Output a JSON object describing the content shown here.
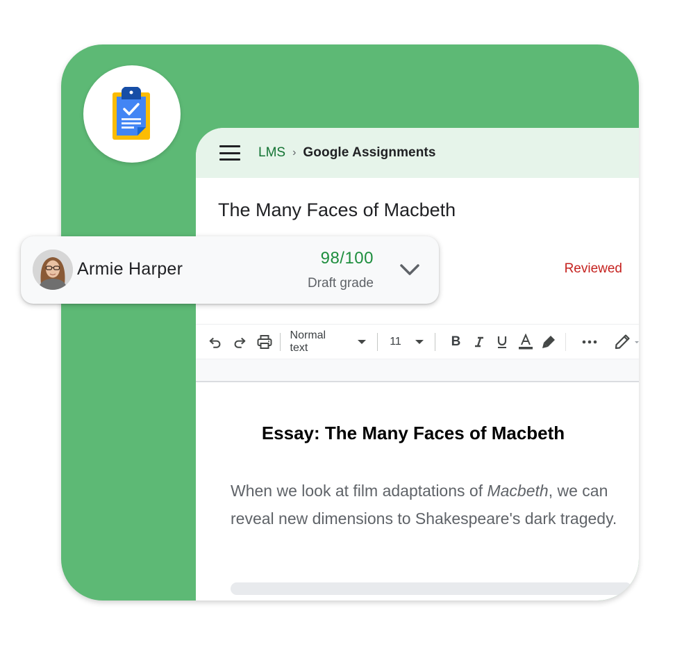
{
  "app": {
    "logo_icon": "clipboard-check-icon"
  },
  "header": {
    "menu_icon": "hamburger-menu-icon",
    "breadcrumb": {
      "root": "LMS",
      "separator": "›",
      "current": "Google Assignments"
    }
  },
  "assignment": {
    "title": "The Many Faces of Macbeth",
    "status": "Reviewed"
  },
  "student": {
    "name": "Armie Harper",
    "grade": "98/100",
    "grade_label": "Draft grade",
    "expand_icon": "chevron-down-icon"
  },
  "toolbar": {
    "undo_icon": "undo-icon",
    "redo_icon": "redo-icon",
    "print_icon": "print-icon",
    "style_select": "Normal text",
    "font_size_select": "11",
    "bold_icon": "bold-icon",
    "italic_icon": "italic-icon",
    "underline_icon": "underline-icon",
    "text_color_icon": "text-color-icon",
    "highlight_icon": "highlighter-icon",
    "more_icon": "more-horizontal-icon",
    "edit_icon": "pencil-icon"
  },
  "document": {
    "heading": "Essay: The Many Faces of Macbeth",
    "paragraph": {
      "before_italic": "When we look at film adaptations of ",
      "italic": "Macbeth",
      "after_italic": ", we can reveal new dimensions to Shakespeare's dark tragedy."
    },
    "placeholder_lines": 3
  },
  "colors": {
    "brand_green": "#5DB975",
    "header_tint": "#E6F4EA",
    "grade_green": "#1E8E3E",
    "status_red": "#C5221F",
    "breadcrumb_green": "#137333"
  }
}
